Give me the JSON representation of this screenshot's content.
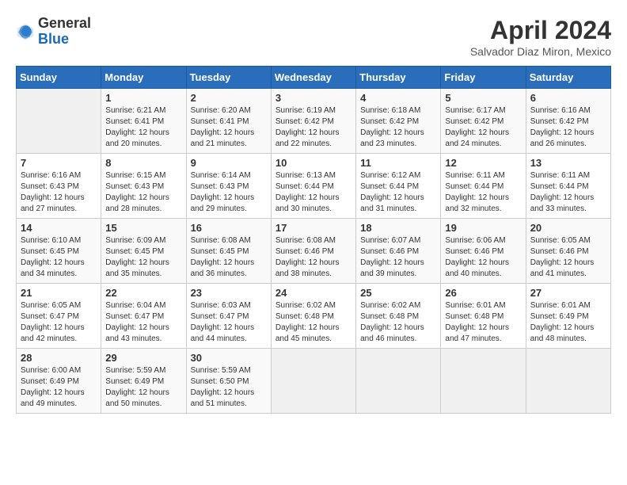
{
  "header": {
    "logo_line1": "General",
    "logo_line2": "Blue",
    "title": "April 2024",
    "subtitle": "Salvador Diaz Miron, Mexico"
  },
  "days_of_week": [
    "Sunday",
    "Monday",
    "Tuesday",
    "Wednesday",
    "Thursday",
    "Friday",
    "Saturday"
  ],
  "weeks": [
    [
      {
        "day": "",
        "sunrise": "",
        "sunset": "",
        "daylight": ""
      },
      {
        "day": "1",
        "sunrise": "Sunrise: 6:21 AM",
        "sunset": "Sunset: 6:41 PM",
        "daylight": "Daylight: 12 hours and 20 minutes."
      },
      {
        "day": "2",
        "sunrise": "Sunrise: 6:20 AM",
        "sunset": "Sunset: 6:41 PM",
        "daylight": "Daylight: 12 hours and 21 minutes."
      },
      {
        "day": "3",
        "sunrise": "Sunrise: 6:19 AM",
        "sunset": "Sunset: 6:42 PM",
        "daylight": "Daylight: 12 hours and 22 minutes."
      },
      {
        "day": "4",
        "sunrise": "Sunrise: 6:18 AM",
        "sunset": "Sunset: 6:42 PM",
        "daylight": "Daylight: 12 hours and 23 minutes."
      },
      {
        "day": "5",
        "sunrise": "Sunrise: 6:17 AM",
        "sunset": "Sunset: 6:42 PM",
        "daylight": "Daylight: 12 hours and 24 minutes."
      },
      {
        "day": "6",
        "sunrise": "Sunrise: 6:16 AM",
        "sunset": "Sunset: 6:42 PM",
        "daylight": "Daylight: 12 hours and 26 minutes."
      }
    ],
    [
      {
        "day": "7",
        "sunrise": "Sunrise: 6:16 AM",
        "sunset": "Sunset: 6:43 PM",
        "daylight": "Daylight: 12 hours and 27 minutes."
      },
      {
        "day": "8",
        "sunrise": "Sunrise: 6:15 AM",
        "sunset": "Sunset: 6:43 PM",
        "daylight": "Daylight: 12 hours and 28 minutes."
      },
      {
        "day": "9",
        "sunrise": "Sunrise: 6:14 AM",
        "sunset": "Sunset: 6:43 PM",
        "daylight": "Daylight: 12 hours and 29 minutes."
      },
      {
        "day": "10",
        "sunrise": "Sunrise: 6:13 AM",
        "sunset": "Sunset: 6:44 PM",
        "daylight": "Daylight: 12 hours and 30 minutes."
      },
      {
        "day": "11",
        "sunrise": "Sunrise: 6:12 AM",
        "sunset": "Sunset: 6:44 PM",
        "daylight": "Daylight: 12 hours and 31 minutes."
      },
      {
        "day": "12",
        "sunrise": "Sunrise: 6:11 AM",
        "sunset": "Sunset: 6:44 PM",
        "daylight": "Daylight: 12 hours and 32 minutes."
      },
      {
        "day": "13",
        "sunrise": "Sunrise: 6:11 AM",
        "sunset": "Sunset: 6:44 PM",
        "daylight": "Daylight: 12 hours and 33 minutes."
      }
    ],
    [
      {
        "day": "14",
        "sunrise": "Sunrise: 6:10 AM",
        "sunset": "Sunset: 6:45 PM",
        "daylight": "Daylight: 12 hours and 34 minutes."
      },
      {
        "day": "15",
        "sunrise": "Sunrise: 6:09 AM",
        "sunset": "Sunset: 6:45 PM",
        "daylight": "Daylight: 12 hours and 35 minutes."
      },
      {
        "day": "16",
        "sunrise": "Sunrise: 6:08 AM",
        "sunset": "Sunset: 6:45 PM",
        "daylight": "Daylight: 12 hours and 36 minutes."
      },
      {
        "day": "17",
        "sunrise": "Sunrise: 6:08 AM",
        "sunset": "Sunset: 6:46 PM",
        "daylight": "Daylight: 12 hours and 38 minutes."
      },
      {
        "day": "18",
        "sunrise": "Sunrise: 6:07 AM",
        "sunset": "Sunset: 6:46 PM",
        "daylight": "Daylight: 12 hours and 39 minutes."
      },
      {
        "day": "19",
        "sunrise": "Sunrise: 6:06 AM",
        "sunset": "Sunset: 6:46 PM",
        "daylight": "Daylight: 12 hours and 40 minutes."
      },
      {
        "day": "20",
        "sunrise": "Sunrise: 6:05 AM",
        "sunset": "Sunset: 6:46 PM",
        "daylight": "Daylight: 12 hours and 41 minutes."
      }
    ],
    [
      {
        "day": "21",
        "sunrise": "Sunrise: 6:05 AM",
        "sunset": "Sunset: 6:47 PM",
        "daylight": "Daylight: 12 hours and 42 minutes."
      },
      {
        "day": "22",
        "sunrise": "Sunrise: 6:04 AM",
        "sunset": "Sunset: 6:47 PM",
        "daylight": "Daylight: 12 hours and 43 minutes."
      },
      {
        "day": "23",
        "sunrise": "Sunrise: 6:03 AM",
        "sunset": "Sunset: 6:47 PM",
        "daylight": "Daylight: 12 hours and 44 minutes."
      },
      {
        "day": "24",
        "sunrise": "Sunrise: 6:02 AM",
        "sunset": "Sunset: 6:48 PM",
        "daylight": "Daylight: 12 hours and 45 minutes."
      },
      {
        "day": "25",
        "sunrise": "Sunrise: 6:02 AM",
        "sunset": "Sunset: 6:48 PM",
        "daylight": "Daylight: 12 hours and 46 minutes."
      },
      {
        "day": "26",
        "sunrise": "Sunrise: 6:01 AM",
        "sunset": "Sunset: 6:48 PM",
        "daylight": "Daylight: 12 hours and 47 minutes."
      },
      {
        "day": "27",
        "sunrise": "Sunrise: 6:01 AM",
        "sunset": "Sunset: 6:49 PM",
        "daylight": "Daylight: 12 hours and 48 minutes."
      }
    ],
    [
      {
        "day": "28",
        "sunrise": "Sunrise: 6:00 AM",
        "sunset": "Sunset: 6:49 PM",
        "daylight": "Daylight: 12 hours and 49 minutes."
      },
      {
        "day": "29",
        "sunrise": "Sunrise: 5:59 AM",
        "sunset": "Sunset: 6:49 PM",
        "daylight": "Daylight: 12 hours and 50 minutes."
      },
      {
        "day": "30",
        "sunrise": "Sunrise: 5:59 AM",
        "sunset": "Sunset: 6:50 PM",
        "daylight": "Daylight: 12 hours and 51 minutes."
      },
      {
        "day": "",
        "sunrise": "",
        "sunset": "",
        "daylight": ""
      },
      {
        "day": "",
        "sunrise": "",
        "sunset": "",
        "daylight": ""
      },
      {
        "day": "",
        "sunrise": "",
        "sunset": "",
        "daylight": ""
      },
      {
        "day": "",
        "sunrise": "",
        "sunset": "",
        "daylight": ""
      }
    ]
  ]
}
